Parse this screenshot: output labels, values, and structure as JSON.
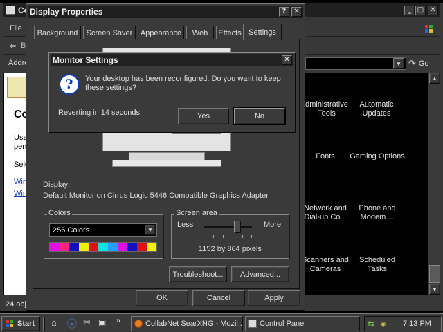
{
  "control_panel": {
    "title_fragment": "Co",
    "menu_file": "File",
    "toolbar_fragment": "B",
    "address_fragment": "Addre",
    "go_label": "Go",
    "heading_fragment": "Co",
    "left_text_1": "Use",
    "left_text_2": "pers",
    "left_text_3": "Sele",
    "left_link_1": "Win",
    "left_link_2": "Win",
    "status_fragment": "24 obj",
    "items": [
      {
        "label": "dministrative Tools"
      },
      {
        "label": "Automatic Updates"
      },
      {
        "label": "Fonts"
      },
      {
        "label": "Gaming Options"
      },
      {
        "label": "Network and Dial-up Co..."
      },
      {
        "label": "Phone and Modem ..."
      },
      {
        "label": "Scanners and Cameras"
      },
      {
        "label": "Scheduled Tasks"
      }
    ]
  },
  "display_properties": {
    "title": "Display Properties",
    "help_glyph": "?",
    "close_glyph": "✕",
    "tabs": [
      "Background",
      "Screen Saver",
      "Appearance",
      "Web",
      "Effects",
      "Settings"
    ],
    "active_tab": "Settings",
    "display_label": "Display:",
    "display_value": "Default Monitor on Cirrus Logic 5446 Compatible Graphics Adapter",
    "colors_group": "Colors",
    "colors_selected": "256 Colors",
    "screen_area_group": "Screen area",
    "less_label": "Less",
    "more_label": "More",
    "resolution": "1152 by 864 pixels",
    "troubleshoot_button": "Troubleshoot...",
    "advanced_button": "Advanced...",
    "ok_button": "OK",
    "cancel_button": "Cancel",
    "apply_button": "Apply"
  },
  "monitor_settings": {
    "title": "Monitor Settings",
    "close_glyph": "✕",
    "icon_glyph": "?",
    "message": "Your desktop has been reconfigured.  Do you want to keep these settings?",
    "countdown": "Reverting in 14 seconds",
    "yes_button": "Yes",
    "no_button": "No"
  },
  "taskbar": {
    "start_label": "Start",
    "chevron": "»",
    "tasks": [
      {
        "label": "CollabNet SearXNG - Mozil..."
      },
      {
        "label": "Control Panel"
      }
    ],
    "clock": "7:13 PM"
  },
  "colors": {
    "title_bar": "#1e1e1e",
    "window_face": "#3a3a3a",
    "help_icon": "#0a3cb4"
  }
}
